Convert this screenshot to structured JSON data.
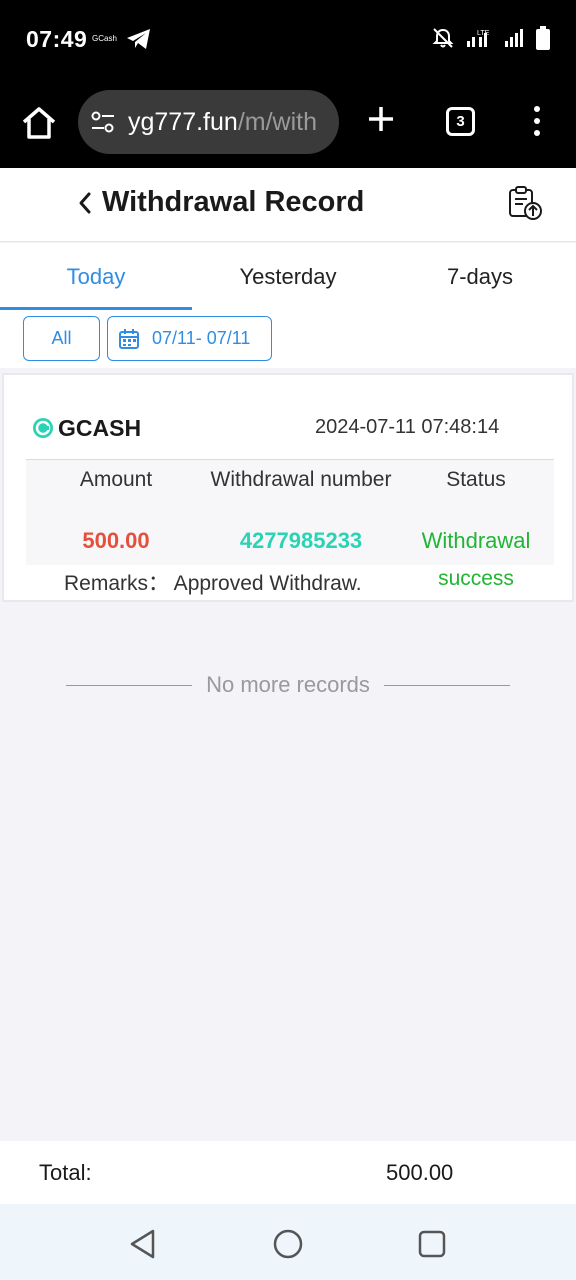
{
  "status_bar": {
    "time": "07:49",
    "notification_app": "GCash",
    "network": "LTE"
  },
  "browser": {
    "url_domain": "yg777.fun",
    "url_path": "/m/with",
    "tab_count": "3"
  },
  "header": {
    "title": "Withdrawal Record"
  },
  "tabs": [
    {
      "label": "Today",
      "active": true
    },
    {
      "label": "Yesterday",
      "active": false
    },
    {
      "label": "7-days",
      "active": false
    }
  ],
  "filters": {
    "type_label": "All",
    "date_range": "07/11- 07/11"
  },
  "record": {
    "method": "GCASH",
    "datetime": "2024-07-11 07:48:14",
    "columns": [
      "Amount",
      "Withdrawal number",
      "Status"
    ],
    "amount": "500.00",
    "withdrawal_number": "4277985233",
    "status_line1": "Withdrawal",
    "status_line2": "success",
    "remarks": "Remarks： Approved Withdraw."
  },
  "list_end_text": "No more records",
  "footer": {
    "total_label": "Total:",
    "total_value": "500.00"
  },
  "colors": {
    "accent": "#2f8de4",
    "amount": "#e4503b",
    "number": "#2bd3b4",
    "success": "#22b534"
  }
}
